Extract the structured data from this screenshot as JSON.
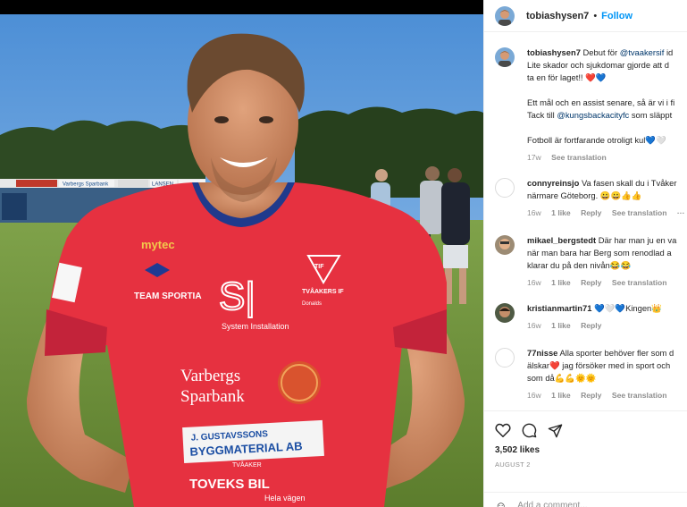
{
  "post": {
    "username": "tobiashysen7",
    "separator": "•",
    "follow_label": "Follow",
    "caption": {
      "username": "tobiashysen7",
      "line1_text": "Debut för ",
      "line1_mention": "@tvaakersif",
      "line1_tail": " id",
      "line2": "Lite skador och sjukdomar gjorde att d",
      "line3": "ta en för laget!! ❤️💙",
      "line4": "Ett mål och en assist senare, så är vi i fi",
      "line5_text": "Tack till ",
      "line5_mention": "@kungsbackacityfc",
      "line5_tail": " som släppt",
      "line6": "Fotboll är fortfarande otroligt kul💙🤍",
      "time": "17w",
      "translate": "See translation"
    },
    "comments": [
      {
        "username": "connyreinsjo",
        "line1": "Va fasen skall du i Tvåker",
        "line2": "närmare Göteborg. 😀😀👍👍",
        "time": "16w",
        "likes": "1 like",
        "reply": "Reply",
        "translate": "See translation",
        "more": "···"
      },
      {
        "username": "mikael_bergstedt",
        "line1": "Där har man ju en va",
        "line2": "när man bara har Berg som renodlad a",
        "line3": "klarar du på den nivån😂😂",
        "time": "16w",
        "likes": "1 like",
        "reply": "Reply",
        "translate": "See translation"
      },
      {
        "username": "kristianmartin71",
        "line1": "💙🤍💙Kingen👑",
        "time": "16w",
        "likes": "1 like",
        "reply": "Reply"
      },
      {
        "username": "77nisse",
        "line1": "Alla sporter behöver fler som d",
        "line2": "älskar❤️ jag försöker med in sport och",
        "line3": "som då💪💪🌞🌞",
        "time": "16w",
        "likes": "1 like",
        "reply": "Reply",
        "translate": "See translation"
      }
    ],
    "like_count": "3,502 likes",
    "date": "AUGUST 2",
    "add_comment_placeholder": "Add a comment..."
  },
  "photo": {
    "jersey_text": {
      "sponsor1": "mytec",
      "sponsor2": "TEAM SPORTIA",
      "sponsor3": "System Installation",
      "sponsor3_logo": "S|",
      "club": "TVÅAKERS IF",
      "club_sub": "Donalds",
      "bank1": "Varbergs",
      "bank2": "Sparbank",
      "banner1": "J. GUSTAVSSONS",
      "banner2": "BYGGMATERIAL AB",
      "banner3": "TVÅAKER",
      "toveks": "TOVEKS BIL",
      "toveks_sub": "Hela vägen",
      "crest": "TIF"
    },
    "billboards": [
      "Varbergs Sparbank",
      "LANSEN",
      "Donalds"
    ]
  },
  "icons": {
    "header_avatar": "avatar-icon",
    "like": "heart-icon",
    "comment": "comment-bubble-icon",
    "share": "paper-plane-icon",
    "emoji": "emoji-icon"
  }
}
